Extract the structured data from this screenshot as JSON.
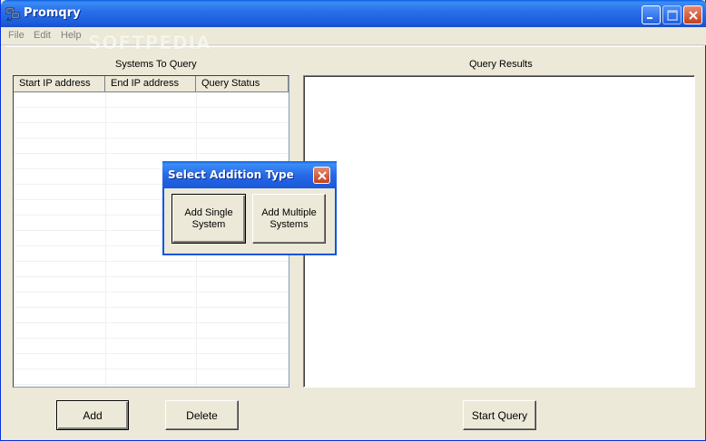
{
  "window": {
    "title": "Promqry",
    "watermark": "SOFTPEDIA"
  },
  "menu": {
    "items": [
      "File",
      "Edit",
      "Help"
    ]
  },
  "systems_panel": {
    "label": "Systems To Query",
    "columns": [
      "Start IP address",
      "End IP address",
      "Query Status"
    ]
  },
  "results_panel": {
    "label": "Query Results"
  },
  "buttons": {
    "add": "Add",
    "delete": "Delete",
    "start_query": "Start Query"
  },
  "dialog": {
    "title": "Select Addition Type",
    "single": "Add Single System",
    "multiple": "Add Multiple Systems"
  },
  "colors": {
    "titlebar": "#2a70ea",
    "window_bg": "#ece9d8",
    "close_button": "#c4401e"
  }
}
